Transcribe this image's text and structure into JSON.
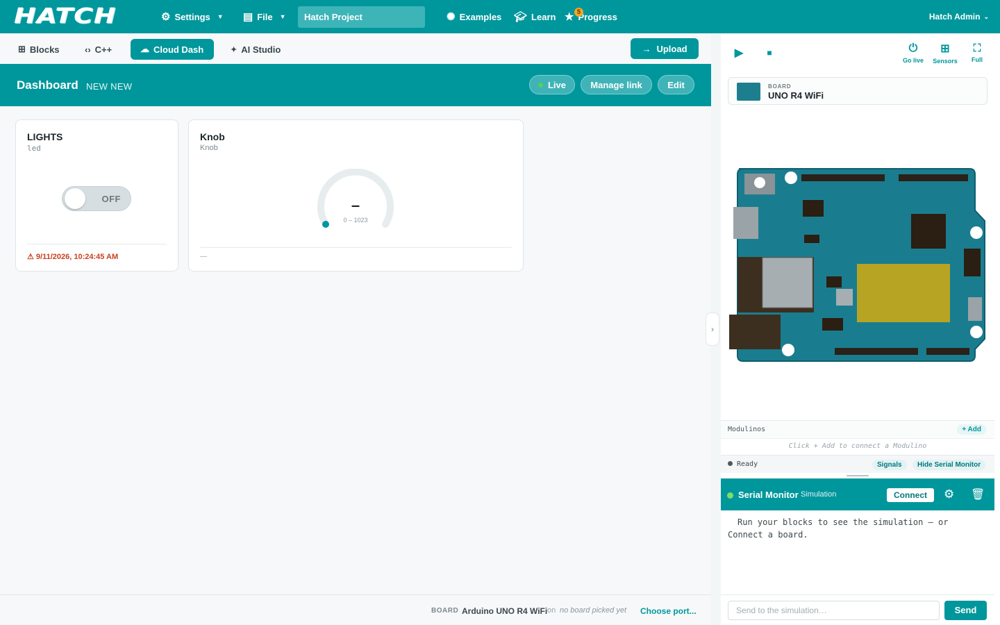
{
  "topbar": {
    "logo": "HATCH",
    "settings": "Settings",
    "file": "File",
    "project_name": "Hatch Project",
    "examples": "Examples",
    "learn": "Learn",
    "progress": "Progress",
    "progress_badge": "5",
    "user": "Hatch Admin"
  },
  "tabs": {
    "blocks": "Blocks",
    "cpp": "C++",
    "cloud_dash": "Cloud Dash",
    "ai_studio": "AI Studio",
    "upload": "Upload"
  },
  "dashboard": {
    "title": "Dashboard",
    "subtitle": "NEW NEW",
    "live": "Live",
    "manage_link": "Manage link",
    "edit": "Edit"
  },
  "widgets": [
    {
      "title": "LIGHTS",
      "variable": "led",
      "toggle_state": "OFF",
      "warning": "⚠ 9/11/2026, 10:24:45 AM"
    },
    {
      "title": "Knob",
      "variable": "Knob",
      "value_display": "–",
      "range": "0 – 1023",
      "footer": "—"
    }
  ],
  "bottom": {
    "board_label": "BOARD",
    "board_name": "Arduino UNO R4 WiFi",
    "on": "on",
    "port_status": "no board picked yet",
    "choose_port": "Choose port..."
  },
  "sim": {
    "go_live": "Go live",
    "sensors": "Sensors",
    "full": "Full",
    "board_caption": "BOARD",
    "board_name": "UNO R4 WiFi",
    "modulinos": "Modulinos",
    "add": "+ Add",
    "modulino_hint": "Click + Add to connect a Modulino",
    "status": "Ready",
    "signals": "Signals",
    "hide_serial": "Hide Serial Monitor"
  },
  "serial": {
    "title": "Serial Monitor",
    "mode": "Simulation",
    "connect": "Connect",
    "output": "Run your blocks to see the simulation — or Connect a board.",
    "placeholder": "Send to the simulation…",
    "send": "Send"
  },
  "colors": {
    "brand": "#00979c",
    "warning": "#c8401e",
    "live_dot": "#52d15b"
  }
}
